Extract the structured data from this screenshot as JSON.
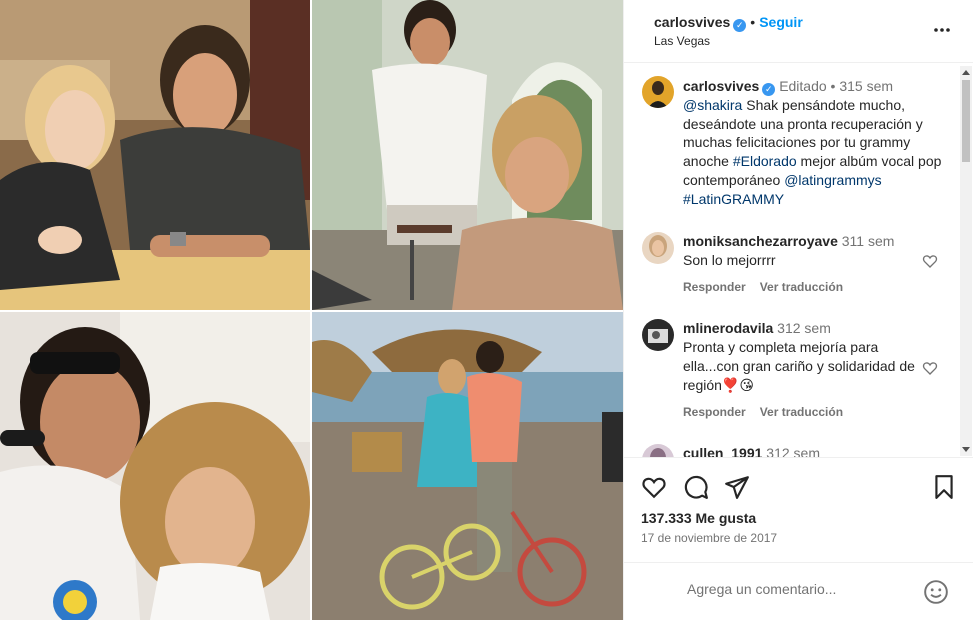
{
  "post": {
    "username": "carlosvives",
    "follow_label": "Seguir",
    "location": "Las Vegas",
    "caption": {
      "username": "carlosvives",
      "edited": "Editado",
      "time": "315 sem",
      "mention": "@shakira",
      "text_1": " Shak pensándote mucho, deseándote una pronta recuperación y muchas felicitaciones por tu grammy anoche ",
      "hashtag_1": "#Eldorado",
      "text_2": " mejor albúm vocal pop contemporáneo ",
      "mention_2": "@latingrammys",
      "hashtag_2": "#LatinGRAMMY"
    },
    "comments": [
      {
        "username": "moniksanchezarroyave",
        "time": "311 sem",
        "text": "Son lo mejorrrr",
        "reply_label": "Responder",
        "translate_label": "Ver traducción"
      },
      {
        "username": "mlinerodavila",
        "time": "312 sem",
        "text": "Pronta y completa mejoría para ella...con gran cariño y solidaridad de región❣️😘",
        "reply_label": "Responder",
        "translate_label": "Ver traducción"
      },
      {
        "username": "cullen_1991",
        "time": "312 sem"
      }
    ],
    "likes": "137.333 Me gusta",
    "date": "17 de noviembre de 2017",
    "comment_placeholder": "Agrega un comentario..."
  },
  "colors": {
    "accent": "#0095f6",
    "verified": "#3897f0",
    "muted": "#737373",
    "link": "#00376b"
  },
  "icons": {
    "more": "more-horizontal-icon",
    "like": "heart-icon",
    "comment": "comment-icon",
    "share": "paper-plane-icon",
    "save": "bookmark-icon",
    "emoji": "emoji-icon"
  }
}
